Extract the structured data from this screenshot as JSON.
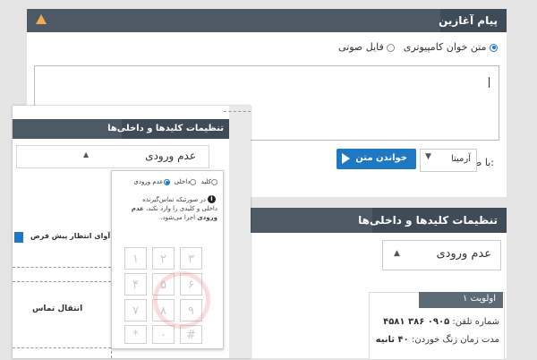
{
  "colors": {
    "header_bar": "#4d5a66",
    "accent_blue": "#1e78c2",
    "warning": "#f0ad4e"
  },
  "start_message": {
    "title": "پیام آغازین",
    "options": [
      {
        "label": "متن خوان کامپیوتری",
        "selected": true
      },
      {
        "label": "فایل صوتی",
        "selected": false
      }
    ],
    "voice_label": "با صدای:",
    "voice_value": "آرمیتا",
    "read_button": "خواندن متن"
  },
  "key_settings_panel": {
    "title": "تنظیمات کلیدها و داخلی‌ها",
    "select_value": "عدم ورودی"
  },
  "key_settings_popup": {
    "title": "تنظیمات کلیدها و داخلی‌ها",
    "select_value": "عدم ورودی",
    "radio_options": [
      {
        "label": "کلید",
        "selected": false
      },
      {
        "label": "داخلی",
        "selected": false
      },
      {
        "label": "عدم ورودی",
        "selected": true
      }
    ],
    "info_line1": "در صورتیکه تماس‌گیرنده",
    "info_line2": "داخلی و کلیدی را وارد نکند،",
    "info_bold": "عدم",
    "info_line3_bold": "ورودی",
    "info_line3_rest": "اجرا می‌شود.",
    "default_wait_label": "آوای انتظار پیش فرض",
    "transfer_label": "انتقال تماس",
    "keys": [
      "۱",
      "۲",
      "۳",
      "۴",
      "۵",
      "۶",
      "۷",
      "۸",
      "۹",
      "*",
      "۰",
      "#"
    ]
  },
  "priority": {
    "title": "اولویت ۱",
    "phone_label": "شماره تلفن:",
    "phone_value": "۰۹۰۵ ۳۸۶ ۴۵۸۱",
    "ring_label": "مدت زمان زنگ خوردن:",
    "ring_value": "۴۰ ثانیه"
  }
}
